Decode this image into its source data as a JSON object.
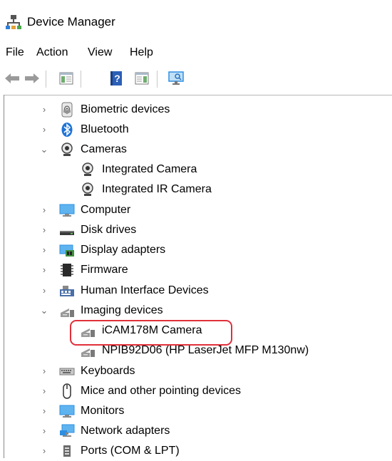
{
  "window": {
    "title": "Device Manager"
  },
  "menu": [
    "File",
    "Action",
    "View",
    "Help"
  ],
  "toolbar": {
    "help_glyph": "?"
  },
  "tree": {
    "items": [
      {
        "label": "Biometric devices",
        "icon": "fingerprint-icon",
        "expanded": false
      },
      {
        "label": "Bluetooth",
        "icon": "bluetooth-icon",
        "expanded": false
      },
      {
        "label": "Cameras",
        "icon": "webcam-icon",
        "expanded": true
      },
      {
        "label": "Integrated Camera",
        "icon": "webcam-icon",
        "child": true
      },
      {
        "label": "Integrated IR Camera",
        "icon": "webcam-icon",
        "child": true
      },
      {
        "label": "Computer",
        "icon": "monitor-icon",
        "expanded": false
      },
      {
        "label": "Disk drives",
        "icon": "disk-drive-icon",
        "expanded": false
      },
      {
        "label": "Display adapters",
        "icon": "display-adapter-icon",
        "expanded": false
      },
      {
        "label": "Firmware",
        "icon": "chip-icon",
        "expanded": false
      },
      {
        "label": "Human Interface Devices",
        "icon": "hid-icon",
        "expanded": false
      },
      {
        "label": "Imaging devices",
        "icon": "imaging-device-icon",
        "expanded": true
      },
      {
        "label": "iCAM178M Camera",
        "icon": "imaging-device-icon",
        "child": true
      },
      {
        "label": "NPIB92D06 (HP LaserJet MFP M130nw)",
        "icon": "imaging-device-icon",
        "child": true
      },
      {
        "label": "Keyboards",
        "icon": "keyboard-icon",
        "expanded": false
      },
      {
        "label": "Mice and other pointing devices",
        "icon": "mouse-icon",
        "expanded": false
      },
      {
        "label": "Monitors",
        "icon": "monitor-icon",
        "expanded": false
      },
      {
        "label": "Network adapters",
        "icon": "network-adapter-icon",
        "expanded": false
      },
      {
        "label": "Ports (COM & LPT)",
        "icon": "port-icon",
        "expanded": false
      }
    ]
  },
  "colors": {
    "highlight": "#e0303a",
    "bluetooth": "#1e73d8",
    "monitor": "#2e8fe0"
  }
}
